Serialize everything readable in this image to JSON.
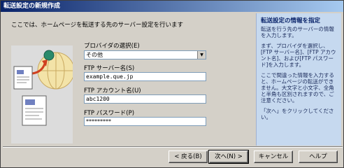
{
  "window": {
    "title": "転送設定の新規作成"
  },
  "main": {
    "description": "ここでは、ホームページを転送する先のサーバー設定を行います",
    "provider": {
      "label": "プロバイダの選択(E)",
      "value": "その他"
    },
    "ftp_server": {
      "label": "FTP サーバー名(S)",
      "value": "example.que.jp"
    },
    "ftp_account": {
      "label": "FTP アカウント名(U)",
      "value": "abc1200"
    },
    "ftp_password": {
      "label": "FTP パスワード(P)",
      "value": "*********"
    }
  },
  "sidebar": {
    "title": "転送設定の情報を指定",
    "paragraphs": [
      "転送を行う先のサーバーの情報を入力します。",
      "まず、プロバイダを選択し、[FTP サーバー名]、[FTP アカウント名]、および[FTP パスワード]を入力します。",
      "ここで間違った情報を入力すると、ホームページの転送ができません。大文字と小文字、全角と半角も区別されますので、ご注意ください。",
      "「次へ」をクリックしてください。"
    ]
  },
  "buttons": {
    "back": "< 戻る(B)",
    "next": "次へ(N) >",
    "cancel": "キャンセル",
    "help": "ヘルプ"
  },
  "colors": {
    "titlebar_start": "#0a246a",
    "titlebar_end": "#a6caf0",
    "sidebar_bg": "#c6d9ef"
  }
}
